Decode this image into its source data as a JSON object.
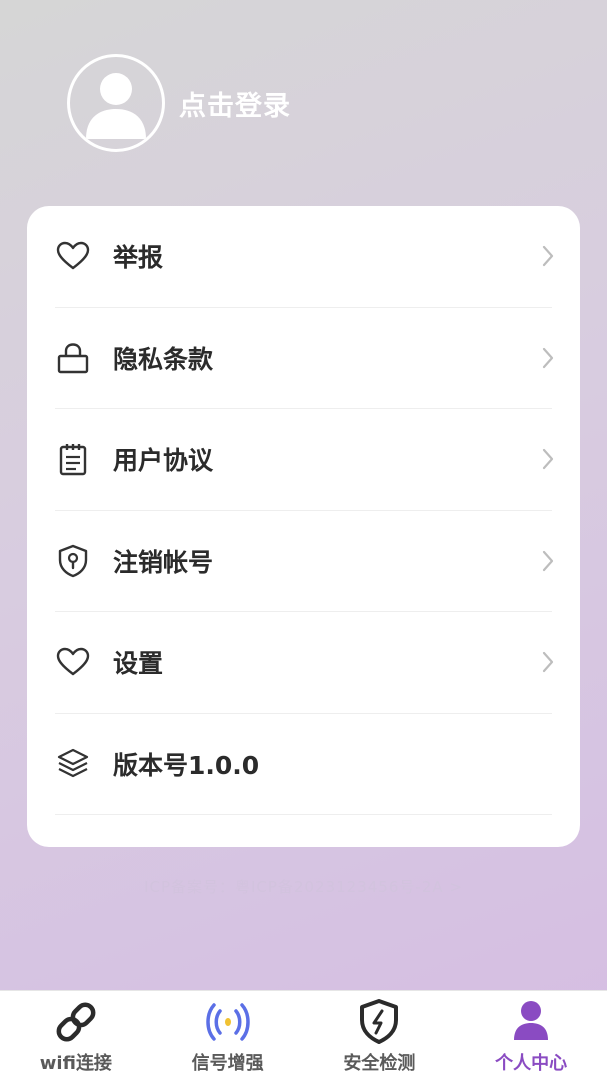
{
  "profile": {
    "login_label": "点击登录"
  },
  "menu": [
    {
      "label": "举报",
      "icon": "heart-icon",
      "has_chevron": true
    },
    {
      "label": "隐私条款",
      "icon": "lock-icon",
      "has_chevron": true
    },
    {
      "label": "用户协议",
      "icon": "notepad-icon",
      "has_chevron": true
    },
    {
      "label": "注销帐号",
      "icon": "shield-keyhole-icon",
      "has_chevron": true
    },
    {
      "label": "设置",
      "icon": "heart-icon",
      "has_chevron": true
    },
    {
      "label": "版本号1.0.0",
      "icon": "layers-icon",
      "has_chevron": false
    }
  ],
  "footer_note": "ICP备案号：粤ICP备2023123456号-2A >",
  "tabs": [
    {
      "label": "wifi连接",
      "icon": "link-icon",
      "active": false
    },
    {
      "label": "信号增强",
      "icon": "signal-icon",
      "active": false
    },
    {
      "label": "安全检测",
      "icon": "shield-bolt-icon",
      "active": false
    },
    {
      "label": "个人中心",
      "icon": "person-icon",
      "active": true
    }
  ],
  "colors": {
    "accent": "#8a4bc2",
    "signal_blue": "#5b6fe6",
    "signal_dot": "#f1c232",
    "text": "#2b2b2b"
  }
}
